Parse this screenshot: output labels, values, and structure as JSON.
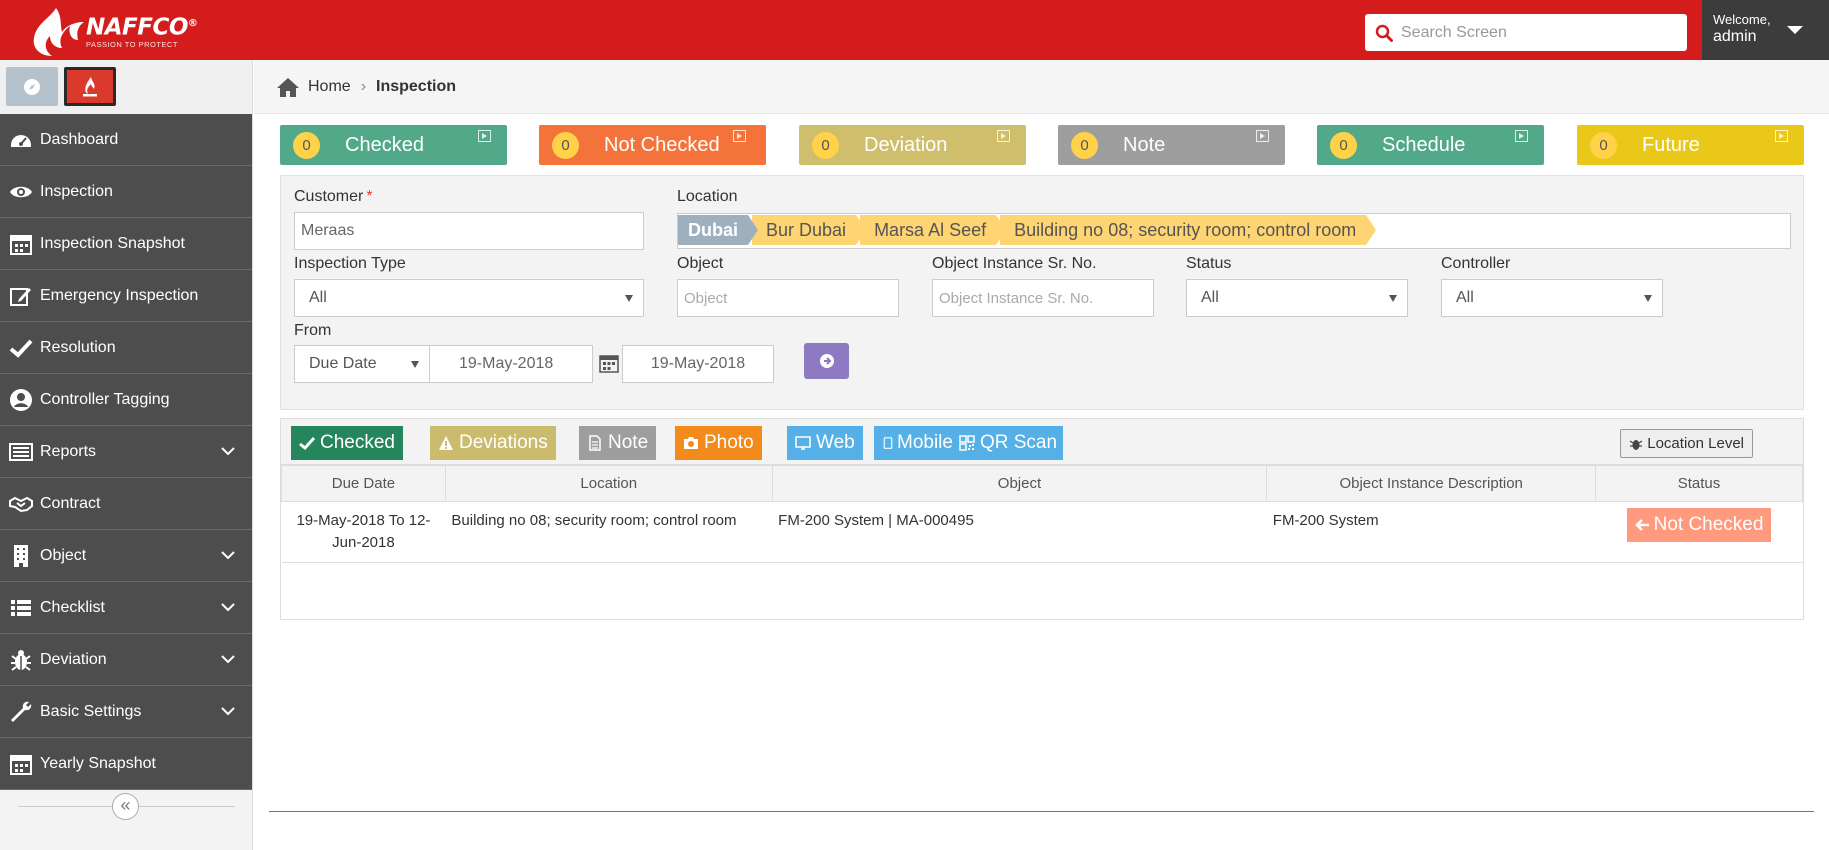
{
  "header": {
    "logo_name": "NAFFCO",
    "logo_tagline": "PASSION TO PROTECT",
    "search_placeholder": "Search Screen",
    "welcome_label": "Welcome,",
    "user_name": "admin",
    "bar_color": "#d41c1c"
  },
  "sidebar": {
    "top_buttons": [
      {
        "icon": "compass-icon"
      },
      {
        "icon": "fire-icon"
      }
    ],
    "items": [
      {
        "label": "Dashboard",
        "icon": "dashboard-icon",
        "expandable": false
      },
      {
        "label": "Inspection",
        "icon": "eye-icon",
        "expandable": false
      },
      {
        "label": "Inspection Snapshot",
        "icon": "calendar-icon",
        "expandable": false
      },
      {
        "label": "Emergency Inspection",
        "icon": "edit-icon",
        "expandable": false
      },
      {
        "label": "Resolution",
        "icon": "check-icon",
        "expandable": false
      },
      {
        "label": "Controller Tagging",
        "icon": "user-circle-icon",
        "expandable": false
      },
      {
        "label": "Reports",
        "icon": "report-icon",
        "expandable": true
      },
      {
        "label": "Contract",
        "icon": "handshake-icon",
        "expandable": false
      },
      {
        "label": "Object",
        "icon": "building-icon",
        "expandable": true
      },
      {
        "label": "Checklist",
        "icon": "list-icon",
        "expandable": true
      },
      {
        "label": "Deviation",
        "icon": "bug-icon",
        "expandable": true
      },
      {
        "label": "Basic Settings",
        "icon": "wrench-icon",
        "expandable": true
      },
      {
        "label": "Yearly Snapshot",
        "icon": "calendar-icon",
        "expandable": false
      }
    ],
    "collapse_glyph": "«"
  },
  "breadcrumb": {
    "home": "Home",
    "current": "Inspection"
  },
  "status_tiles": [
    {
      "label": "Checked",
      "count": "0",
      "color": "#52a98a"
    },
    {
      "label": "Not Checked",
      "count": "0",
      "color": "#f4733a"
    },
    {
      "label": "Deviation",
      "count": "0",
      "color": "#cfbf6c"
    },
    {
      "label": "Note",
      "count": "0",
      "color": "#9e9e9e"
    },
    {
      "label": "Schedule",
      "count": "0",
      "color": "#52a98a"
    },
    {
      "label": "Future",
      "count": "0",
      "color": "#e9c819"
    }
  ],
  "filters": {
    "customer_label": "Customer",
    "customer_required": "*",
    "customer_value": "Meraas",
    "location_label": "Location",
    "location_path": [
      "Dubai",
      "Bur Dubai",
      "Marsa Al Seef",
      "Building no 08; security room; control room"
    ],
    "inspection_type_label": "Inspection Type",
    "inspection_type_value": "All",
    "object_label": "Object",
    "object_placeholder": "Object",
    "instance_label": "Object Instance Sr. No.",
    "instance_placeholder": "Object Instance Sr. No.",
    "status_label": "Status",
    "status_value": "All",
    "controller_label": "Controller",
    "controller_value": "All",
    "from_label": "From",
    "date_type_value": "Due Date",
    "date_from": "19-May-2018",
    "date_to": "19-May-2018"
  },
  "result_toolbar": {
    "buttons": [
      {
        "label": "Checked",
        "icon": "check-icon",
        "color": "#25865d"
      },
      {
        "label": "Deviations",
        "icon": "warning-icon",
        "color": "#cbbc6d"
      },
      {
        "label": "Note",
        "icon": "note-icon",
        "color": "#9e9e9e"
      },
      {
        "label": "Photo",
        "icon": "camera-icon",
        "color": "#f28a1c"
      },
      {
        "label": "Web",
        "icon": "monitor-icon",
        "color": "#54b0e6"
      },
      {
        "label": "Mobile",
        "icon": "mobile-icon",
        "color": "#54b0e6"
      },
      {
        "label": "QR Scan",
        "icon": "qr-icon",
        "color": "#54b0e6"
      }
    ],
    "location_level": "Location Level"
  },
  "table": {
    "columns": [
      "Due Date",
      "Location",
      "Object",
      "Object Instance Description",
      "Status"
    ],
    "rows": [
      {
        "due_date": "19-May-2018 To 12-Jun-2018",
        "location": "Building no 08; security room; control room",
        "object": "FM-200 System | MA-000495",
        "instance": "FM-200 System",
        "status": "Not Checked"
      }
    ]
  }
}
